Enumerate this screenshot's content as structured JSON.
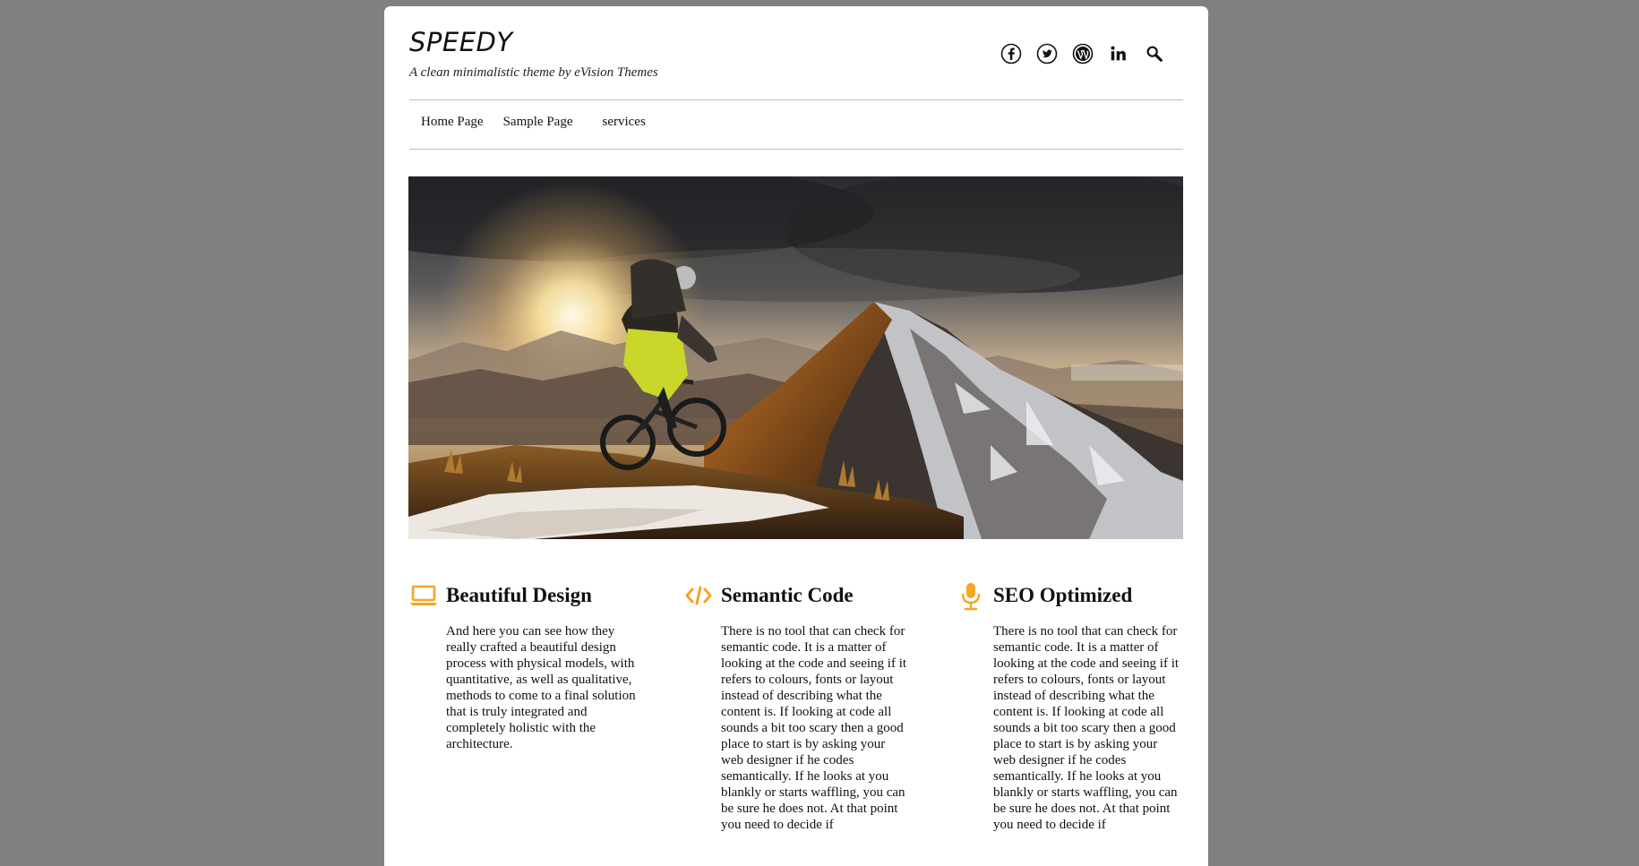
{
  "site": {
    "title": "SPEEDY",
    "tagline": "A clean minimalistic theme by eVision Themes"
  },
  "social": {
    "icons": [
      "facebook-icon",
      "twitter-icon",
      "wordpress-icon",
      "linkedin-icon",
      "search-icon"
    ]
  },
  "nav": {
    "items": [
      {
        "label": "Home Page"
      },
      {
        "label": "Sample Page"
      },
      {
        "label": "services"
      }
    ]
  },
  "hero": {
    "image": "mountain-biker-at-sunset"
  },
  "features": [
    {
      "icon": "laptop-icon",
      "title": "Beautiful Design",
      "text": "And here you can see how they really crafted a beautiful design process with physical models, with quantitative, as well as qualitative, methods to come to a final solution that is truly integrated and completely holistic with the architecture."
    },
    {
      "icon": "code-icon",
      "title": "Semantic Code",
      "text": "There is no tool that can check for semantic code. It is a matter of looking at the code and seeing if it refers to colours, fonts or layout instead of describing what the content is. If looking at code all sounds a bit too scary then a good place to start is by asking your web designer if he codes semantically. If he looks at you blankly or starts waffling, you can be sure he does not. At that point you need to decide if"
    },
    {
      "icon": "microphone-icon",
      "title": "SEO Optimized",
      "text": "There is no tool that can check for semantic code. It is a matter of looking at the code and seeing if it refers to colours, fonts or layout instead of describing what the content is. If looking at code all sounds a bit too scary then a good place to start is by asking your web designer if he codes semantically. If he looks at you blankly or starts waffling, you can be sure he does not. At that point you need to decide if"
    }
  ],
  "colors": {
    "background": "#808080",
    "page": "#ffffff",
    "accent": "#f5a623"
  }
}
